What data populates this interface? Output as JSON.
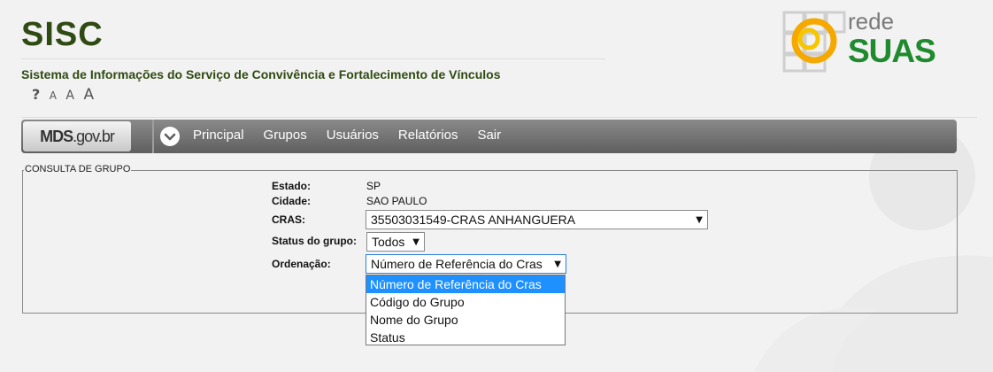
{
  "header": {
    "title": "SISC",
    "subtitle": "Sistema de Informações do Serviço de Convivência e Fortalecimento de Vínculos",
    "font_tools": {
      "help": "?",
      "small": "A",
      "medium": "A",
      "large": "A"
    }
  },
  "logo": {
    "line1": "rede",
    "line2": "SUAS"
  },
  "navbar": {
    "brand_bold": "MDS",
    "brand_rest": ".gov.br",
    "menu": [
      "Principal",
      "Grupos",
      "Usuários",
      "Relatórios",
      "Sair"
    ]
  },
  "form": {
    "legend": "CONSULTA DE GRUPO",
    "estado_label": "Estado:",
    "estado_value": "SP",
    "cidade_label": "Cidade:",
    "cidade_value": "SAO PAULO",
    "cras_label": "CRAS:",
    "cras_value": "35503031549-CRAS ANHANGUERA",
    "status_label": "Status do grupo:",
    "status_value": "Todos",
    "ordenacao_label": "Ordenação:",
    "ordenacao_value": "Número de Referência do Cras",
    "ordenacao_options": [
      "Número de Referência do Cras",
      "Código do Grupo",
      "Nome do Grupo",
      "Status"
    ]
  },
  "colors": {
    "title_green": "#2f4a12",
    "suas_green": "#1f8a2e",
    "selected_option": "#1e90ff",
    "navbar": "#6e6e6e"
  }
}
